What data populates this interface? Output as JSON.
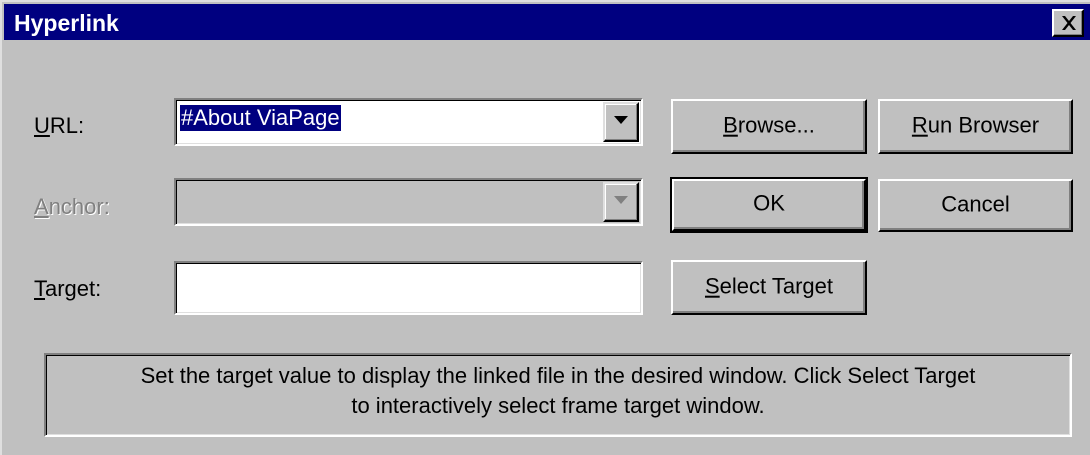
{
  "window": {
    "title": "Hyperlink"
  },
  "icons": {
    "close": "close-icon",
    "dropdown": "chevron-down-icon"
  },
  "labels": {
    "url": {
      "mnemonic": "U",
      "rest": "RL:"
    },
    "anchor": {
      "mnemonic": "A",
      "rest": "nchor:"
    },
    "target": {
      "mnemonic": "T",
      "rest": "arget:"
    }
  },
  "fields": {
    "url": {
      "value": "#About ViaPage",
      "selected": true
    },
    "anchor": {
      "value": "",
      "disabled": true
    },
    "target": {
      "value": ""
    }
  },
  "buttons": {
    "browse": {
      "mnemonic": "B",
      "rest": "rowse..."
    },
    "run_browser": {
      "mnemonic": "R",
      "rest": "un Browser"
    },
    "ok": {
      "label": "OK"
    },
    "cancel": {
      "label": "Cancel"
    },
    "select_target": {
      "mnemonic": "S",
      "rest": "elect Target"
    }
  },
  "status": {
    "line1": "Set the target value to display the linked file in the desired window. Click Select Target",
    "line2": "to interactively select frame target window."
  },
  "colors": {
    "titlebar": "#000080",
    "face": "#c0c0c0",
    "selection": "#000080"
  }
}
